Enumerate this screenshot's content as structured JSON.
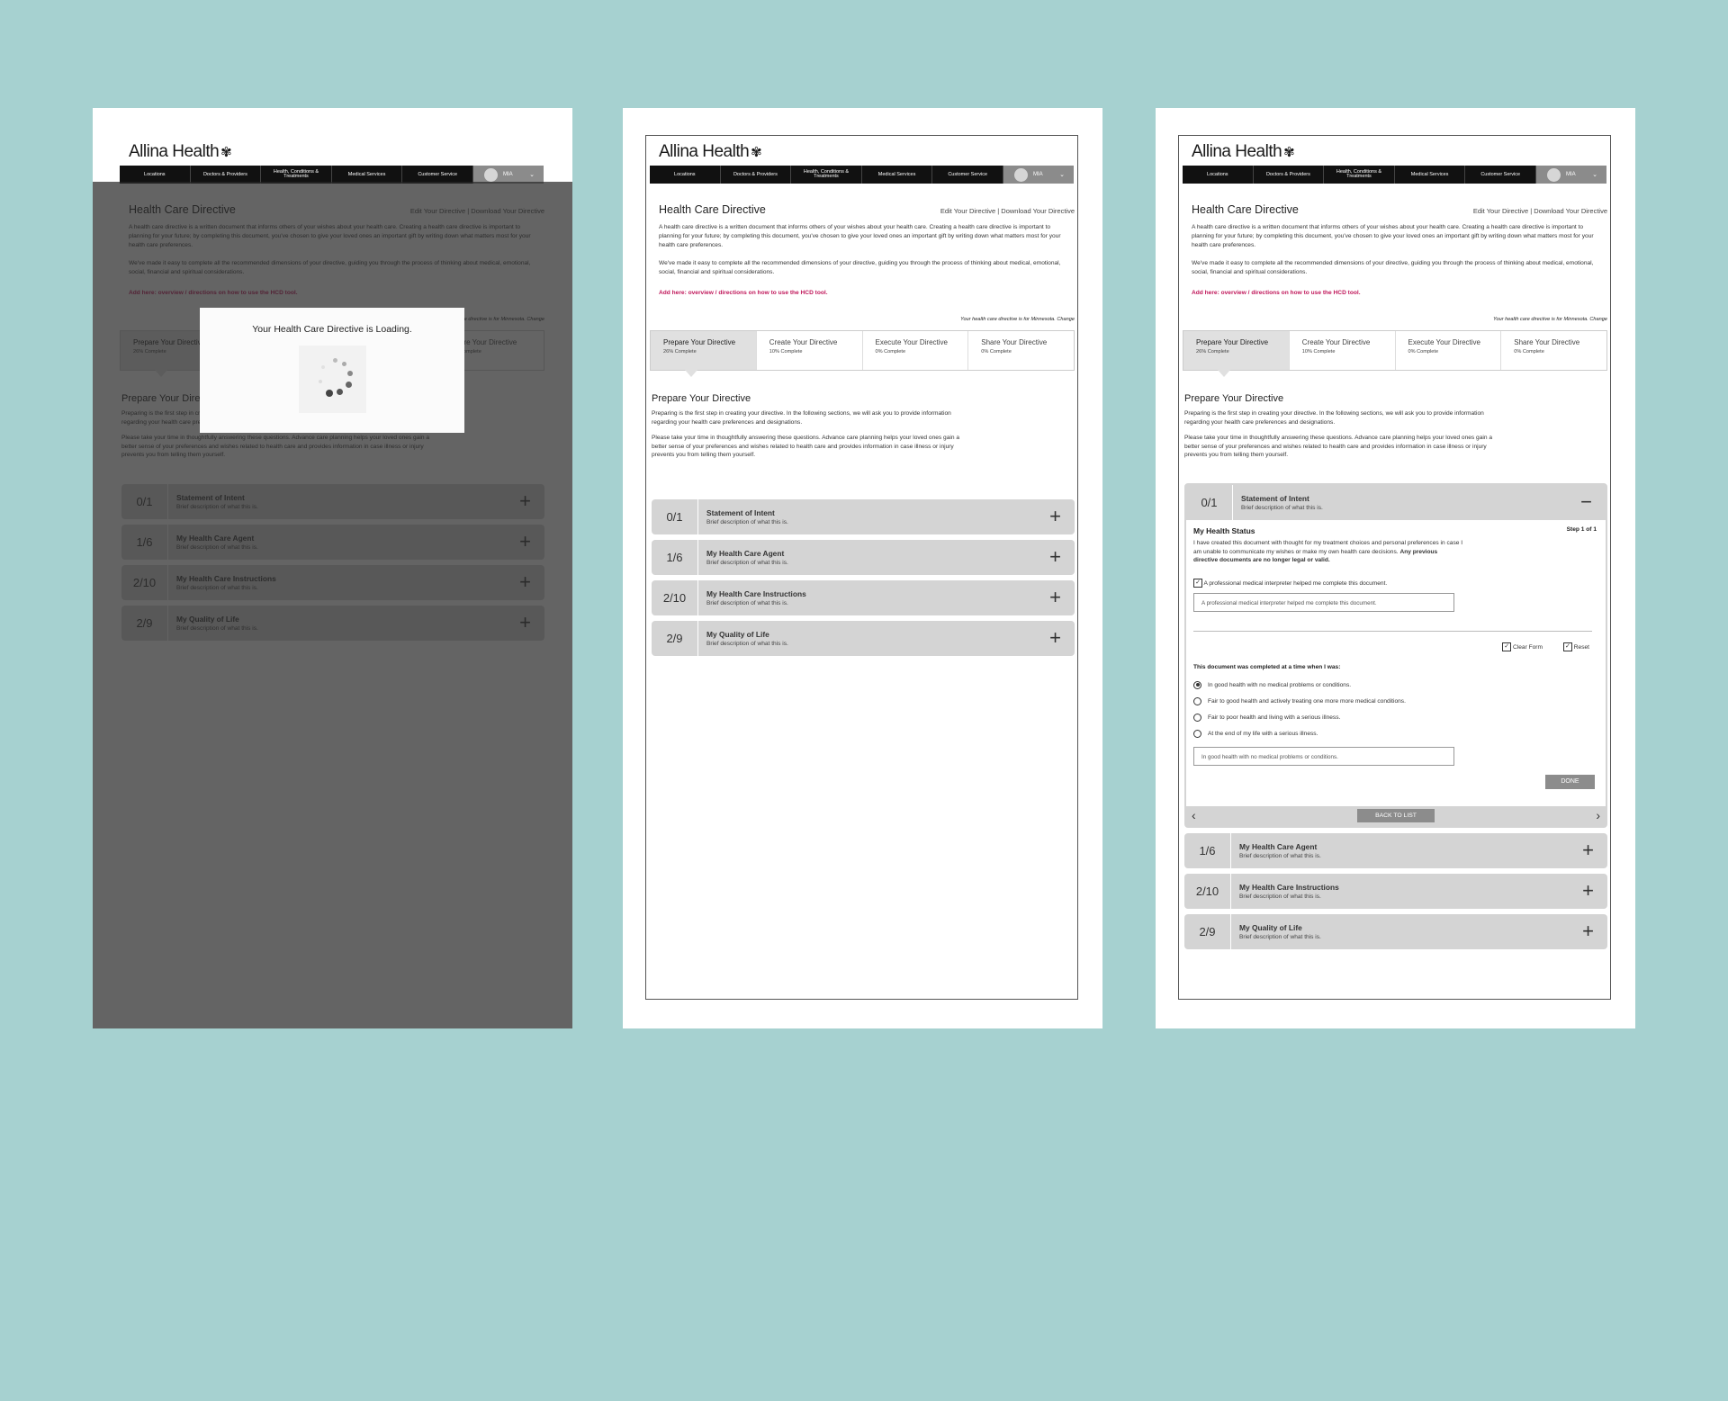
{
  "common": {
    "logo": "Allina Health",
    "nav": [
      "Locations",
      "Doctors & Providers",
      "Health, Conditions & Treatments",
      "Medical Services",
      "Customer Service"
    ],
    "user": "MIA",
    "title": "Health Care Directive",
    "edit_link": "Edit Your Directive",
    "download_link": "Download Your Directive",
    "separator": "|",
    "intro_p1": "A health care directive is a written document that informs others of your wishes about your health care.  Creating a health care directive is important to planning for your future;  by completing this document, you've chosen to give your loved ones an important gift by writing down what matters most for your health care preferences.",
    "intro_p2": "We've made it easy to complete all the recommended dimensions of your directive, guiding you through the process of thinking about medical, emotional, social, financial and spiritual considerations.",
    "add_here": "Add here:  overview / directions on how to use the HCD tool.",
    "state_note": "Your health care directive is for Minnesota. Change",
    "steps": [
      {
        "name": "Prepare Your Directive",
        "pct": "26% Complete"
      },
      {
        "name": "Create Your Directive",
        "pct": "10% Complete"
      },
      {
        "name": "Execute Your Directive",
        "pct": "0% Complete"
      },
      {
        "name": "Share Your Directive",
        "pct": "0% Complete"
      }
    ],
    "section_title": "Prepare Your Directive",
    "section_p1": "Preparing is the first step in creating your directive.   In the following sections, we will ask you to provide information regarding your health care preferences and designations.",
    "section_p2": "Please take your time in thoughtfully answering these questions. Advance care planning helps your loved ones gain a better sense of your preferences and wishes related to health care and provides information in case illness or injury prevents you from telling them yourself.",
    "accordions": [
      {
        "count": "0/1",
        "name": "Statement of Intent",
        "desc": "Brief description of what this is."
      },
      {
        "count": "1/6",
        "name": "My Health Care Agent",
        "desc": "Brief description of what this is."
      },
      {
        "count": "2/10",
        "name": "My Health Care Instructions",
        "desc": "Brief description of what this is."
      },
      {
        "count": "2/9",
        "name": "My Quality of Life",
        "desc": "Brief description of what this is."
      }
    ],
    "plus": "+",
    "minus": "−"
  },
  "loading": {
    "message": "Your Health Care Directive is Loading."
  },
  "form": {
    "title": "My Health Status",
    "step": "Step 1 of 1",
    "para_a": "I have created this document with thought for my treatment choices and personal preferences in case I am unable to communicate my wishes or make my own health care decisions.",
    "para_b": "Any previous directive documents are no longer legal or valid.",
    "interpreter_check": "A professional medical interpreter helped me complete this document.",
    "interpreter_value": "A professional medical interpreter helped me complete this document.",
    "clear_form": "Clear Form",
    "reset": "Reset",
    "question": "This document was completed at a time when I was:",
    "options": [
      "In good health with no medical problems or conditions.",
      "Fair to good health and actively treating one more more medical conditions.",
      "Fair to poor health and living with a serious illness.",
      "At the end of my life with a serious illness."
    ],
    "selected_index": 0,
    "answer_value": "In good health with no medical problems or conditions.",
    "done": "DONE",
    "back_to_list": "BACK TO LIST",
    "prev": "‹",
    "next": "›",
    "check_mark": "✓"
  }
}
